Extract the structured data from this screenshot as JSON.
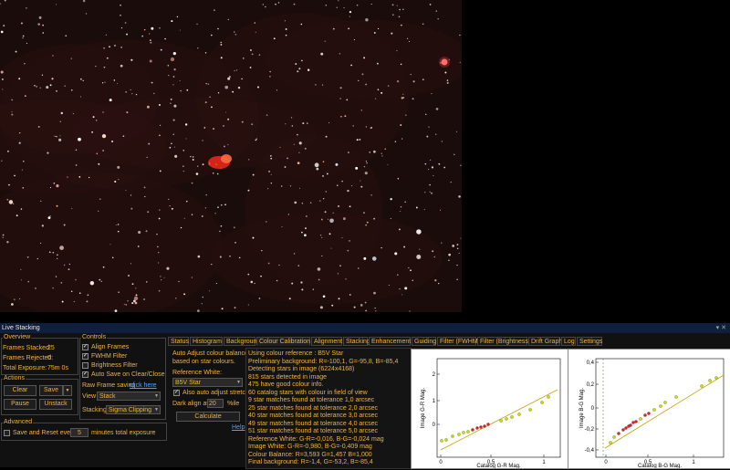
{
  "window": {
    "title": "Live Stacking",
    "controls": "▾ ✕"
  },
  "overview": {
    "label": "Overview",
    "frames_stacked_label": "Frames Stacked:",
    "frames_stacked": "25",
    "frames_rejected_label": "Frames Rejected:",
    "frames_rejected": "0",
    "total_exposure_label": "Total Exposure:",
    "total_exposure": "75m 0s"
  },
  "actions": {
    "label": "Actions",
    "clear": "Clear",
    "save": "Save",
    "pause": "Pause",
    "unstack": "Unstack"
  },
  "advanced": {
    "label": "Advanced",
    "save_reset_label": "Save and Reset every",
    "save_reset_value": "5",
    "minutes_label": "minutes total exposure"
  },
  "controls": {
    "label": "Controls",
    "align_frames": "Align Frames",
    "fwhm_filter": "FWHM Filter",
    "brightness_filter": "Brightness Filter",
    "auto_save": "Auto Save on Clear/Close",
    "raw_frame_saving": "Raw Frame saving",
    "click_here": "click here",
    "view_label": "View",
    "view_value": "Stack",
    "stacking_label": "Stacking",
    "stacking_value": "Sigma Clipping"
  },
  "tabs": [
    "Status",
    "Histogram",
    "Background",
    "Colour Calibration",
    "Alignment",
    "Stacking",
    "Enhancement",
    "Guiding",
    "Filter (FWHM)",
    "Filter (Brightness)",
    "Drift Graph",
    "Log",
    "Settings"
  ],
  "active_tab": "Colour Calibration",
  "calibration": {
    "auto_adjust_1": "Auto Adjust colour balance",
    "auto_adjust_2": "based on star colours.",
    "reference_white_label": "Reference White:",
    "reference_value": "B5V Star",
    "also_auto_stretch": "Also auto adjust stretch",
    "dark_align_label": "Dark align at",
    "dark_align_value": "20",
    "percentile_label": "%ile",
    "calculate": "Calculate",
    "help": "Help"
  },
  "log_lines": [
    "Using colour reference : B5V Star",
    "Preliminary background:      R=-100,1, G=-95,8, B=-85,4",
    "Detecting stars in image (6224x4168)",
    "815 stars detected in image",
    "475 have good colour info.",
    "60 catalog stars with colour in field of view",
    "9 star matches found at tolerance 1,0 arcsec",
    "25 star matches found at tolerance 2,0 arcsec",
    "40 star matches found at tolerance 3,0 arcsec",
    "49 star matches found at tolerance 4,0 arcsec",
    "51 star matches found at tolerance 5,0 arcsec",
    "Reference White:  G-R=-0,016, B-G=-0,024 mag",
    "Image White:       G-R=-0,980, B-G=-0,409 mag",
    "Colour Balance:    R=3,593 G=1,457 B=1,000",
    "Final background: R=-1,4, G=-53,2, B=-85,4"
  ],
  "plots": [
    {
      "ylabel": "Image G-R Mag.",
      "xlabel": "Catalog G-R Mag.",
      "yticks": [
        "2",
        "1",
        "0"
      ],
      "xticks": [
        "0",
        "0,5",
        "1"
      ]
    },
    {
      "ylabel": "Image B-G Mag.",
      "xlabel": "Catalog B-G Mag.",
      "yticks": [
        "0,4",
        "0,2",
        "0",
        "-0,2",
        "-0,4"
      ],
      "xticks": [
        "0",
        "0,5",
        "1"
      ]
    }
  ],
  "colors": {
    "accent": "#f2b23a",
    "titlebar": "#0f1f3d",
    "panel": "#111111",
    "fit_line": "#c8a000",
    "point_green": "#c6e000",
    "point_red": "#e02020"
  }
}
